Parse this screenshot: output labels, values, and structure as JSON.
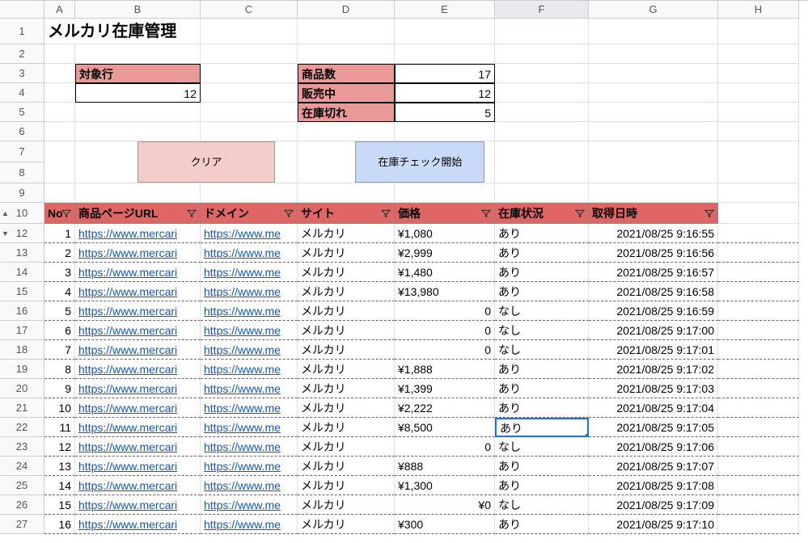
{
  "title": "メルカリ在庫管理",
  "labels": {
    "target_row": "対象行",
    "product_count": "商品数",
    "on_sale": "販売中",
    "out_of_stock": "在庫切れ"
  },
  "values": {
    "target_row": "12",
    "product_count": "17",
    "on_sale": "12",
    "out_of_stock": "5"
  },
  "buttons": {
    "clear": "クリア",
    "check_stock": "在庫チェック開始"
  },
  "columns": [
    "A",
    "B",
    "C",
    "D",
    "E",
    "F",
    "G",
    "H"
  ],
  "row_numbers_top": [
    "1",
    "2",
    "3",
    "4",
    "5",
    "6",
    "7",
    "8",
    "9"
  ],
  "headers": {
    "no": "No",
    "url": "商品ページURL",
    "domain": "ドメイン",
    "site": "サイト",
    "price": "価格",
    "stock": "在庫状況",
    "datetime": "取得日時"
  },
  "header_row": "10",
  "data": [
    {
      "row": "12",
      "no": "1",
      "url": "https://www.mercari",
      "domain": "https://www.me",
      "site": "メルカリ",
      "price": "¥1,080",
      "stock": "あり",
      "dt": "2021/08/25 9:16:55"
    },
    {
      "row": "13",
      "no": "2",
      "url": "https://www.mercari",
      "domain": "https://www.me",
      "site": "メルカリ",
      "price": "¥2,999",
      "stock": "あり",
      "dt": "2021/08/25 9:16:56"
    },
    {
      "row": "14",
      "no": "3",
      "url": "https://www.mercari",
      "domain": "https://www.me",
      "site": "メルカリ",
      "price": "¥1,480",
      "stock": "あり",
      "dt": "2021/08/25 9:16:57"
    },
    {
      "row": "15",
      "no": "4",
      "url": "https://www.mercari",
      "domain": "https://www.me",
      "site": "メルカリ",
      "price": "¥13,980",
      "stock": "あり",
      "dt": "2021/08/25 9:16:58"
    },
    {
      "row": "16",
      "no": "5",
      "url": "https://www.mercari",
      "domain": "https://www.me",
      "site": "メルカリ",
      "price": "0",
      "price_align": "right",
      "stock": "なし",
      "dt": "2021/08/25 9:16:59"
    },
    {
      "row": "17",
      "no": "6",
      "url": "https://www.mercari",
      "domain": "https://www.me",
      "site": "メルカリ",
      "price": "0",
      "price_align": "right",
      "stock": "なし",
      "dt": "2021/08/25 9:17:00"
    },
    {
      "row": "18",
      "no": "7",
      "url": "https://www.mercari",
      "domain": "https://www.me",
      "site": "メルカリ",
      "price": "0",
      "price_align": "right",
      "stock": "なし",
      "dt": "2021/08/25 9:17:01"
    },
    {
      "row": "19",
      "no": "8",
      "url": "https://www.mercari",
      "domain": "https://www.me",
      "site": "メルカリ",
      "price": "¥1,888",
      "stock": "あり",
      "dt": "2021/08/25 9:17:02"
    },
    {
      "row": "20",
      "no": "9",
      "url": "https://www.mercari",
      "domain": "https://www.me",
      "site": "メルカリ",
      "price": "¥1,399",
      "stock": "あり",
      "dt": "2021/08/25 9:17:03"
    },
    {
      "row": "21",
      "no": "10",
      "url": "https://www.mercari",
      "domain": "https://www.me",
      "site": "メルカリ",
      "price": "¥2,222",
      "stock": "あり",
      "dt": "2021/08/25 9:17:04"
    },
    {
      "row": "22",
      "no": "11",
      "url": "https://www.mercari",
      "domain": "https://www.me",
      "site": "メルカリ",
      "price": "¥8,500",
      "stock": "あり",
      "dt": "2021/08/25 9:17:05",
      "selected": true
    },
    {
      "row": "23",
      "no": "12",
      "url": "https://www.mercari",
      "domain": "https://www.me",
      "site": "メルカリ",
      "price": "0",
      "price_align": "right",
      "stock": "なし",
      "dt": "2021/08/25 9:17:06"
    },
    {
      "row": "24",
      "no": "13",
      "url": "https://www.mercari",
      "domain": "https://www.me",
      "site": "メルカリ",
      "price": "¥888",
      "stock": "あり",
      "dt": "2021/08/25 9:17:07"
    },
    {
      "row": "25",
      "no": "14",
      "url": "https://www.mercari",
      "domain": "https://www.me",
      "site": "メルカリ",
      "price": "¥1,300",
      "stock": "あり",
      "dt": "2021/08/25 9:17:08"
    },
    {
      "row": "26",
      "no": "15",
      "url": "https://www.mercari",
      "domain": "https://www.me",
      "site": "メルカリ",
      "price": "¥0",
      "price_align": "right",
      "stock": "なし",
      "dt": "2021/08/25 9:17:09"
    },
    {
      "row": "27",
      "no": "16",
      "url": "https://www.mercari",
      "domain": "https://www.me",
      "site": "メルカリ",
      "price": "¥300",
      "stock": "あり",
      "dt": "2021/08/25 9:17:10"
    }
  ]
}
